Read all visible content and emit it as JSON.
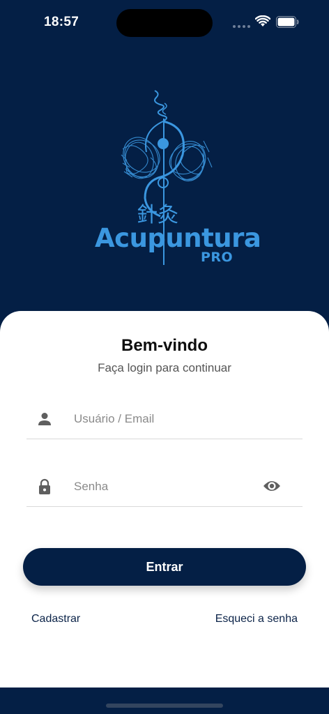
{
  "status_bar": {
    "time": "18:57"
  },
  "brand": {
    "cjk": "針灸",
    "name": "Acupuntura",
    "suffix": "PRO",
    "color": "#3b97e0"
  },
  "login": {
    "title": "Bem-vindo",
    "subtitle": "Faça login para continuar",
    "user_placeholder": "Usuário / Email",
    "password_placeholder": "Senha",
    "submit_label": "Entrar",
    "register_label": "Cadastrar",
    "forgot_label": "Esqueci a senha"
  },
  "icons": {
    "user": "person-icon",
    "password": "lock-icon",
    "toggle": "eye-icon"
  },
  "colors": {
    "background": "#041f45",
    "accent": "#3b97e0",
    "card": "#ffffff"
  }
}
